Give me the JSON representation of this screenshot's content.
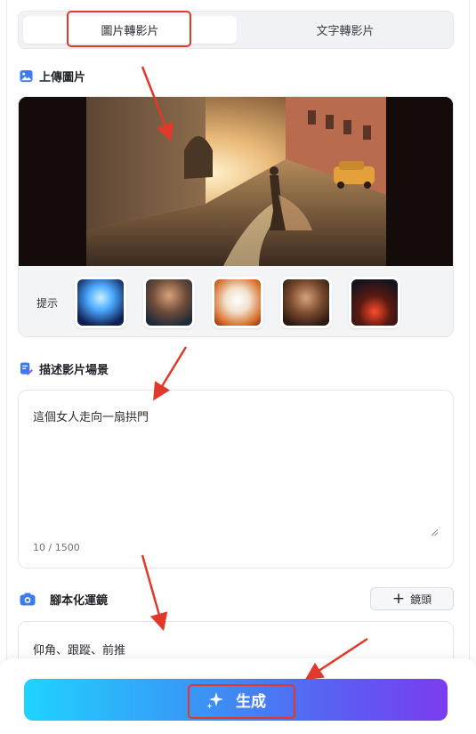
{
  "tabs": [
    {
      "label": "圖片轉影片",
      "active": true
    },
    {
      "label": "文字轉影片",
      "active": false
    }
  ],
  "upload": {
    "title": "上傳圖片",
    "hints_label": "提示",
    "hint_thumbnails": [
      "glowing-woman",
      "armored-woman",
      "white-kitten",
      "long-haired-man",
      "car-in-tunnel"
    ]
  },
  "description": {
    "title": "描述影片場景",
    "value": "這個女人走向一扇拱門",
    "counter": "10 / 1500"
  },
  "script": {
    "title": "腳本化運鏡",
    "add_shot_label": "鏡頭",
    "value": "仰角、跟蹤、前推"
  },
  "generate": {
    "label": "生成"
  },
  "colors": {
    "accent_gradient_start": "#1fd3ff",
    "accent_gradient_end": "#7a3cf0",
    "callout_red": "#e0392b"
  }
}
